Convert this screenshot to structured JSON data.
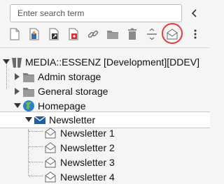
{
  "search": {
    "placeholder": "Enter search term"
  },
  "toolbar": {
    "buttons": [
      {
        "name": "new-page-icon"
      },
      {
        "name": "new-shortcut-page-icon"
      },
      {
        "name": "new-external-link-page-icon"
      },
      {
        "name": "new-mount-point-icon"
      },
      {
        "name": "new-link-icon"
      },
      {
        "name": "new-folder-icon"
      },
      {
        "name": "new-recycler-icon"
      },
      {
        "name": "new-spacer-icon"
      },
      {
        "name": "new-newsletter-page-icon"
      },
      {
        "name": "more-options-icon"
      }
    ],
    "highlighted": "new-newsletter-page-icon",
    "highlight_color": "#e53935"
  },
  "tree": {
    "root_label": "MEDIA::ESSENZ [Development][DDEV]",
    "admin_storage": "Admin storage",
    "general_storage": "General storage",
    "homepage": "Homepage",
    "newsletter": "Newsletter",
    "children": [
      "Newsletter 1",
      "Newsletter 2",
      "Newsletter 3",
      "Newsletter 4"
    ]
  }
}
